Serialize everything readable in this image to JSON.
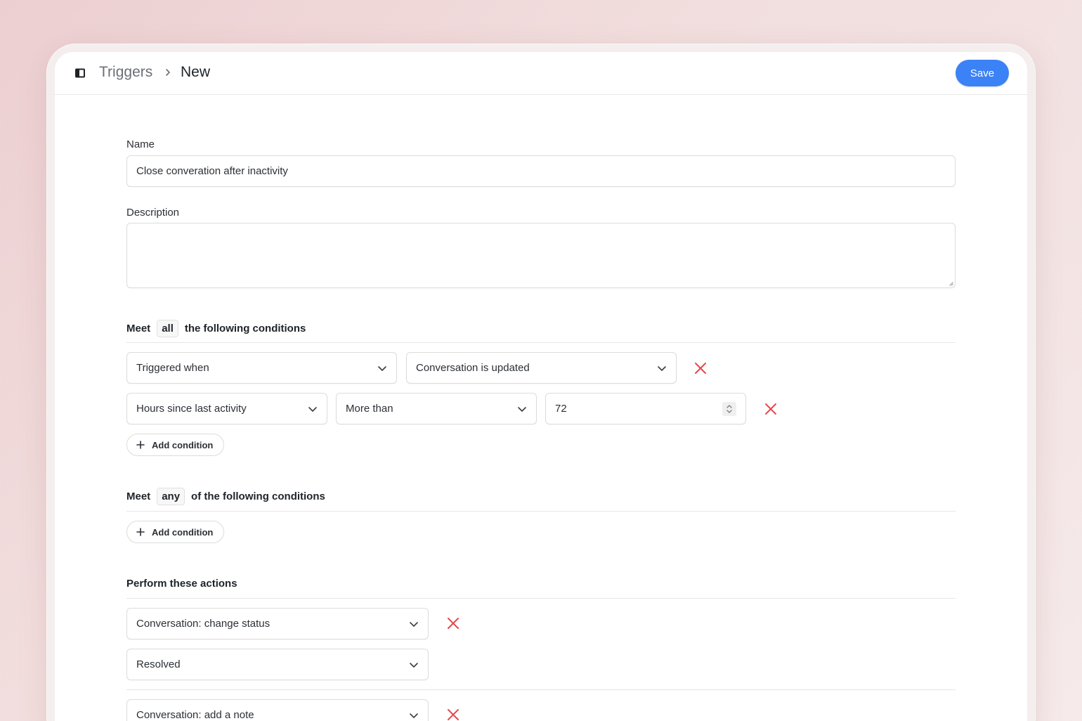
{
  "header": {
    "breadcrumb_parent": "Triggers",
    "breadcrumb_current": "New",
    "save_label": "Save"
  },
  "form": {
    "name_label": "Name",
    "name_value": "Close converation after inactivity",
    "description_label": "Description",
    "description_value": ""
  },
  "all_conditions": {
    "prefix": "Meet",
    "quantifier": "all",
    "suffix": "the following conditions",
    "rows": [
      {
        "field": "Triggered when",
        "operator": "Conversation is updated"
      },
      {
        "field": "Hours since last activity",
        "operator": "More than",
        "value": "72"
      }
    ],
    "add_label": "Add condition"
  },
  "any_conditions": {
    "prefix": "Meet",
    "quantifier": "any",
    "suffix": "of the following conditions",
    "add_label": "Add condition"
  },
  "actions": {
    "title": "Perform these actions",
    "items": [
      {
        "action": "Conversation: change status",
        "value": "Resolved"
      },
      {
        "action": "Conversation: add a note"
      }
    ]
  },
  "colors": {
    "accent": "#3b82f6",
    "remove": "#e5484d"
  },
  "icons": {
    "sidebar": "sidebar-toggle-icon",
    "separator": "chevron-right-icon",
    "dropdown": "chevron-down-icon",
    "remove": "close-icon",
    "add": "plus-icon",
    "stepper": "stepper-icon"
  }
}
